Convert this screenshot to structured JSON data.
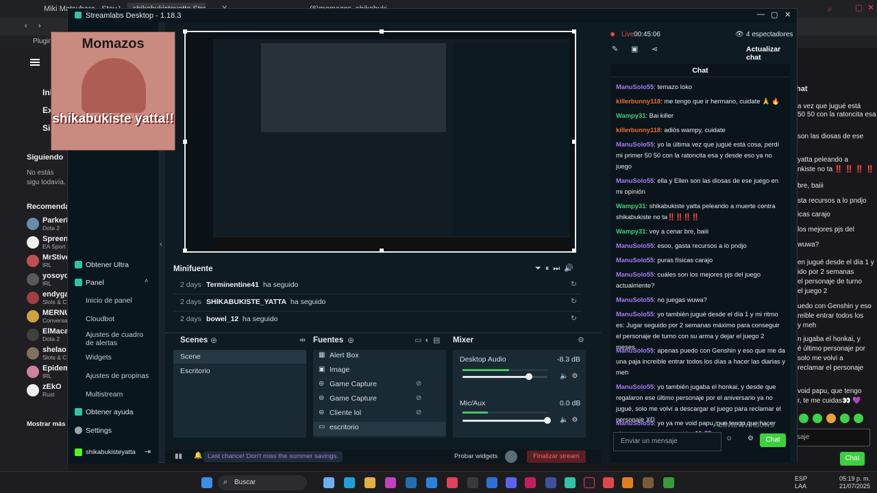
{
  "browser": {
    "tabs": [
      "Miki Matsubara - Stay Wi…",
      "shikabukisteyatta Stream…",
      "X",
      "(6)momazos_shikabukist…"
    ],
    "bookmark": "Plugins",
    "left_nav": {
      "items": [
        "Ini",
        "Ex",
        "Sig"
      ],
      "following_title": "Siguiendo",
      "following_empty": "No estás sigu todavía.",
      "recommended_title": "Recomendad",
      "show_more": "Mostrar más"
    },
    "recommended": [
      {
        "name": "ParkerD",
        "game": "Dota 2"
      },
      {
        "name": "Spreen",
        "game": "EA Sport"
      },
      {
        "name": "MrStive",
        "game": "IRL"
      },
      {
        "name": "yosoyc",
        "game": "IRL"
      },
      {
        "name": "endyga",
        "game": "Slots & C"
      },
      {
        "name": "MERNU",
        "game": "Conversa"
      },
      {
        "name": "ElMaca",
        "game": "Dota 2"
      },
      {
        "name": "shelao",
        "game": "Slots & C"
      },
      {
        "name": "Epidem",
        "game": "IRL"
      },
      {
        "name": "zEkO",
        "game": "Rust"
      }
    ],
    "right_chat": {
      "header": "hat",
      "lines": [
        "a vez que jugué está",
        "50 50 con la ratoncita esa",
        "son las diosas de ese",
        "yatta peleando a",
        "nkiste no ta ‼️ ‼️ ‼️ ‼️",
        "bre, baiii",
        "sta recursos a lo pndjo",
        "icas carajo",
        "los mejores pjs del",
        "wuwa?",
        "en jugué desde el día 1 y",
        "ido por 2 semanas",
        "el personaje de turno",
        "el juego 2",
        "uedo con Genshin y eso",
        "reible entrar todos los",
        "y meh",
        "n jugaba el honkai, y",
        "é último personaje por",
        "solo me volví a",
        "reclamar el personaje",
        "void papu, que tengo",
        "r, te me cuidas👀 💜"
      ],
      "input": "saje",
      "button": "Chat"
    }
  },
  "app": {
    "title": "Streamlabs Desktop - 1.18.3",
    "sidebar": {
      "obtener_ultra": "Obtener Ultra",
      "panel": "Panel",
      "sub": [
        "Inicio de panel",
        "Cloudbot",
        "Ajustes de cuadro de alertas",
        "Widgets",
        "Ajustes de propinas",
        "Multistream"
      ],
      "help": "Obtener ayuda",
      "settings": "Settings",
      "user": "shikabukisteyatta"
    },
    "overlay": {
      "title": "Momazos",
      "caption": "shikabukiste yatta!!"
    },
    "minifeed": {
      "title": "Minifuente",
      "rows": [
        {
          "time": "2 days",
          "name": "Terminentine41",
          "action": "ha seguido"
        },
        {
          "time": "2 days",
          "name": "SHIKABUKISTE_YATTA",
          "action": "ha seguido"
        },
        {
          "time": "2 days",
          "name": "bowel_12",
          "action": "ha seguido"
        }
      ]
    },
    "scenes": {
      "title": "Scenes",
      "items": [
        "Scene",
        "Escritorio"
      ]
    },
    "sources": {
      "title": "Fuentes",
      "items": [
        "Alert Box",
        "Image",
        "Game Capture",
        "Game Capture",
        "Cliente lol",
        "escritorio"
      ]
    },
    "mixer": {
      "title": "Mixer",
      "channels": [
        {
          "name": "Desktop Audio",
          "db": "-8.3 dB",
          "level": 0.78,
          "meter": 0.55
        },
        {
          "name": "Mic/Aux",
          "db": "0.0 dB",
          "level": 1.0,
          "meter": 0.3
        }
      ]
    },
    "bottom": {
      "promo": "Last chance! Don't miss the summer savings.",
      "test_widgets": "Probar widgets",
      "end_stream": "Finalizar stream"
    },
    "chatpane": {
      "live": "Live",
      "time": "00:45:06",
      "viewers": "4 espectadores",
      "update_chat": "Actualizar chat",
      "chat_title": "Chat",
      "input_placeholder": "Enviar un mensaje",
      "send": "Chat",
      "watermark": "Activar Windows",
      "watermark2": "Ve a Configuración para activar Windows."
    }
  },
  "chat_messages": [
    {
      "user": "ManuSolo55",
      "color": "purple",
      "text": ": temazo loko"
    },
    {
      "user": "killerbunny118",
      "color": "orange",
      "text": ": me tengo que ir hermano, cuidate 🙏 🔥"
    },
    {
      "user": "Wampy31",
      "color": "green",
      "text": ": Bai killer"
    },
    {
      "user": "killerbunny118",
      "color": "orange",
      "text": ": adiós wampy, cuidate"
    },
    {
      "user": "ManuSolo55",
      "color": "purple",
      "text": ": yo la última vez que jugué está cosa, perdí mi primer 50 50 con la ratoncita esa y desde eso ya no juego"
    },
    {
      "user": "ManuSolo55",
      "color": "purple",
      "text": ": ella y Ellen son las diosas de ese juego en mi opinión"
    },
    {
      "user": "Wampy31",
      "color": "green",
      "text": ": shikabukiste yatta peleando a muerte contra shikabukiste no ta‼️‼️‼️‼️"
    },
    {
      "user": "Wampy31",
      "color": "green",
      "text": ": voy a cenar bre, baiii"
    },
    {
      "user": "ManuSolo55",
      "color": "purple",
      "text": ": esoo, gasta recursos a lo pndjo"
    },
    {
      "user": "ManuSolo55",
      "color": "purple",
      "text": ": puras físicas carajo"
    },
    {
      "user": "ManuSolo55",
      "color": "purple",
      "text": ": cuáles son los mejores pjs del juego actualmente?"
    },
    {
      "user": "ManuSolo55",
      "color": "purple",
      "text": ": no juegas wuwa?"
    },
    {
      "user": "ManuSolo55",
      "color": "purple",
      "text": ": yo también jugué desde el día 1 y mi ritmo es: Jugar seguido por 2 semanas máximo para conseguir el personaje de turno con su arma y dejar el juego 2 meses."
    },
    {
      "user": "ManuSolo55",
      "color": "purple",
      "text": ": apenas puedo con Genshin y eso que me da una paja increible entrar todos los días a hacer las diarias y meh"
    },
    {
      "user": "ManuSolo55",
      "color": "purple",
      "text": ": yo también jugaba el honkai, y desde que regalaron ese último personaje por el aniversario ya no jugué, solo me volví a descargar el juego para reclamar el personaje XD"
    },
    {
      "user": "ManuSolo55",
      "color": "purple",
      "text": ": yo ya me void papu, que tengo que hacer algo pa cenar, te me cuidas👀 💜"
    }
  ],
  "taskbar": {
    "search": "Buscar",
    "lang": "ESP",
    "lang2": "LAA",
    "time": "05:19 p. m.",
    "date": "21/07/2025"
  },
  "colors": {
    "accent": "#31c3a2",
    "green_button": "#3ecf3e",
    "end_stream": "#5a1f23"
  }
}
